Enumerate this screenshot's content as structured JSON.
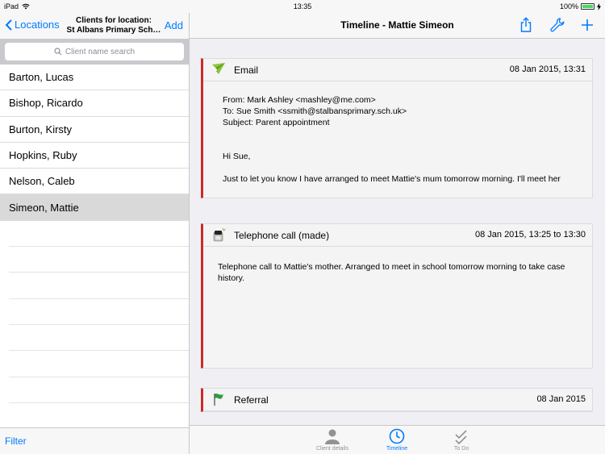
{
  "status_bar": {
    "device": "iPad",
    "time": "13:35",
    "battery": "100%",
    "battery_level": 1.0
  },
  "left_nav": {
    "back_label": "Locations",
    "title_line1": "Clients for location:",
    "title_line2": "St Albans Primary Sch…",
    "add_label": "Add"
  },
  "search": {
    "placeholder": "Client name search"
  },
  "clients": [
    {
      "name": "Barton, Lucas"
    },
    {
      "name": "Bishop, Ricardo"
    },
    {
      "name": "Burton, Kirsty"
    },
    {
      "name": "Hopkins, Ruby"
    },
    {
      "name": "Nelson, Caleb"
    },
    {
      "name": "Simeon, Mattie"
    }
  ],
  "filter_label": "Filter",
  "right_nav": {
    "title": "Timeline - Mattie Simeon"
  },
  "timeline": {
    "email": {
      "type": "Email",
      "date": "08 Jan 2015, 13:31",
      "from": "From: Mark Ashley <mashley@me.com>",
      "to": "To: Sue Smith <ssmith@stalbansprimary.sch.uk>",
      "subject": "Subject: Parent appointment",
      "greeting": "Hi Sue,",
      "body": "Just to let you know I have arranged to meet Mattie's mum tomorrow morning. I'll meet her"
    },
    "call": {
      "type": "Telephone call (made)",
      "date": "08 Jan 2015, 13:25 to 13:30",
      "body": "Telephone call to Mattie's mother. Arranged to meet in school tomorrow morning to take case history."
    },
    "referral": {
      "type": "Referral",
      "date": "08 Jan 2015"
    }
  },
  "tabs": [
    {
      "label": "Client details"
    },
    {
      "label": "Timeline"
    },
    {
      "label": "To Do"
    }
  ],
  "colors": {
    "accent": "#007aff",
    "timeline_bar": "#cc2a2a",
    "selected_row": "#d9d9d9"
  }
}
